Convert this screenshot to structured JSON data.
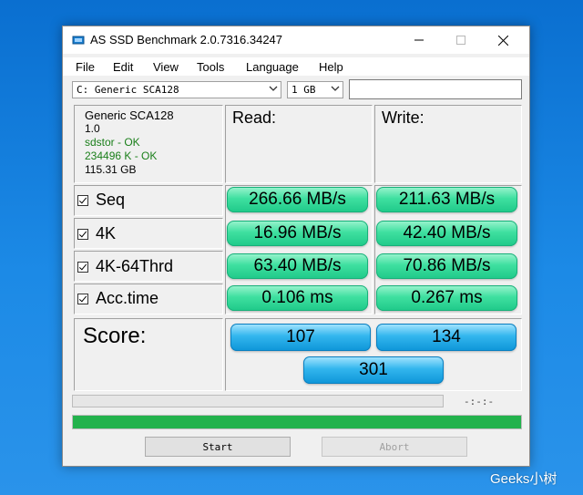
{
  "window": {
    "title": "AS SSD Benchmark 2.0.7316.34247"
  },
  "menu": [
    "File",
    "Edit",
    "View",
    "Tools",
    "Language",
    "Help"
  ],
  "drive_select": {
    "value": "C: Generic SCA128"
  },
  "size_select": {
    "value": "1 GB"
  },
  "device": {
    "name": "Generic SCA128",
    "firmware": "1.0",
    "driver_status": "sdstor - OK",
    "alignment_status": "234496 K - OK",
    "capacity": "115.31 GB"
  },
  "columns": {
    "read": "Read:",
    "write": "Write:"
  },
  "rows": [
    {
      "label": "Seq",
      "read": "266.66 MB/s",
      "write": "211.63 MB/s"
    },
    {
      "label": "4K",
      "read": "16.96 MB/s",
      "write": "42.40 MB/s"
    },
    {
      "label": "4K-64Thrd",
      "read": "63.40 MB/s",
      "write": "70.86 MB/s"
    },
    {
      "label": "Acc.time",
      "read": "0.106 ms",
      "write": "0.267 ms"
    }
  ],
  "score": {
    "label": "Score:",
    "read": "107",
    "write": "134",
    "total": "301"
  },
  "progress": {
    "time": "-:-:-",
    "overall_fraction": 1.0
  },
  "buttons": {
    "start": "Start",
    "abort": "Abort"
  },
  "colors": {
    "result_green": "#3fe0a0",
    "score_blue": "#33b6ee",
    "progress_green": "#22b24c"
  },
  "watermark": "Geeks小树"
}
